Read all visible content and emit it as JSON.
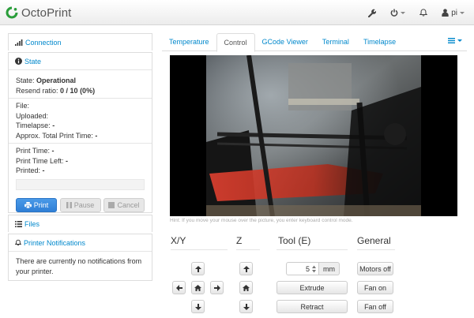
{
  "app": {
    "brand": "OctoPrint",
    "brand_color": "#2a9d3a",
    "link_color": "#0088cc"
  },
  "navbar": {
    "icons": [
      "wrench-icon",
      "power-icon",
      "bell-icon",
      "user-icon"
    ],
    "user": "pi"
  },
  "sidebar": {
    "connection": {
      "label": "Connection",
      "icon": "signal-icon"
    },
    "state": {
      "label": "State",
      "icon": "info-icon",
      "state_label": "State:",
      "state_value": "Operational",
      "resend_label": "Resend ratio:",
      "resend_value": "0 / 10 (0%)",
      "file_label": "File:",
      "uploaded_label": "Uploaded:",
      "timelapse_label": "Timelapse:",
      "timelapse_value": "-",
      "approx_label": "Approx. Total Print Time:",
      "approx_value": "-",
      "print_time_label": "Print Time:",
      "print_time_value": "-",
      "time_left_label": "Print Time Left:",
      "time_left_value": "-",
      "printed_label": "Printed:",
      "printed_value": "-",
      "progress": 0,
      "buttons": {
        "print": "Print",
        "pause": "Pause",
        "cancel": "Cancel"
      }
    },
    "files": {
      "label": "Files",
      "icon": "list-icon"
    },
    "notifications": {
      "label": "Printer Notifications",
      "icon": "bell-icon",
      "message": "There are currently no notifications from your printer."
    }
  },
  "tabs": [
    {
      "label": "Temperature",
      "active": false
    },
    {
      "label": "Control",
      "active": true
    },
    {
      "label": "GCode Viewer",
      "active": false
    },
    {
      "label": "Terminal",
      "active": false
    },
    {
      "label": "Timelapse",
      "active": false
    }
  ],
  "control": {
    "hint": "Hint: If you move your mouse over the picture, you enter keyboard control mode.",
    "xy_title": "X/Y",
    "z_title": "Z",
    "tool_title": "Tool (E)",
    "general_title": "General",
    "tool_amount": "5",
    "tool_unit": "mm",
    "extrude": "Extrude",
    "retract": "Retract",
    "motors_off": "Motors off",
    "fan_on": "Fan on",
    "fan_off": "Fan off"
  }
}
